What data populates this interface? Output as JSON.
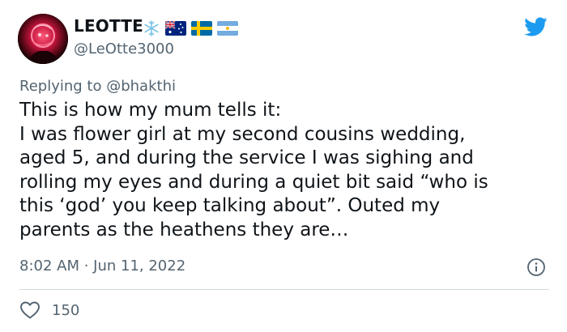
{
  "tweet": {
    "display_name": "LEOTTE",
    "handle": "@LeOtte3000",
    "name_icons": [
      "snowflake-icon",
      "australia-flag-icon",
      "sweden-flag-icon",
      "argentina-flag-icon"
    ],
    "replying_prefix": "Replying to",
    "replying_to": "@bhakthi",
    "body_lines": [
      "This is how my mum tells it:",
      "I was flower girl at my second cousins wedding,",
      "aged 5, and during the service I was sighing and",
      "rolling my eyes and during a quiet bit said “who is",
      "this ‘god’ you keep talking about”. Outed my",
      "parents as the heathens they are…"
    ],
    "timestamp": "8:02 AM · Jun 11, 2022",
    "likes": "150"
  },
  "colors": {
    "twitter_blue": "#1d9bf0",
    "secondary_text": "#536471",
    "primary_text": "#0f1419",
    "divider": "#cfd9de"
  }
}
